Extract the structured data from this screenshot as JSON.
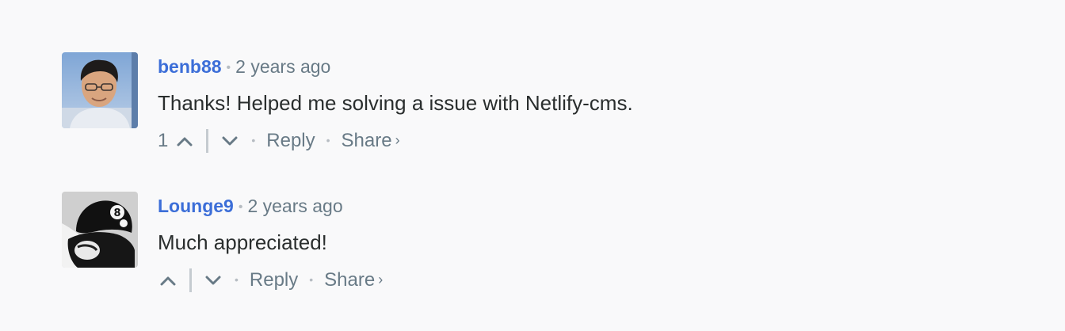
{
  "comments": [
    {
      "author": "benb88",
      "time": "2 years ago",
      "message": "Thanks! Helped me solving a issue with Netlify-cms.",
      "votes": "1",
      "reply_label": "Reply",
      "share_label": "Share",
      "share_chevron": "›",
      "avatar_icon": "user-photo-avatar"
    },
    {
      "author": "Lounge9",
      "time": "2 years ago",
      "message": "Much appreciated!",
      "votes": "",
      "reply_label": "Reply",
      "share_label": "Share",
      "share_chevron": "›",
      "avatar_icon": "user-photo-avatar"
    }
  ],
  "separator": "•",
  "colors": {
    "author": "#3c6ed8",
    "meta": "#687a86",
    "message": "#2a2e2e",
    "background": "#f9f9fa"
  }
}
